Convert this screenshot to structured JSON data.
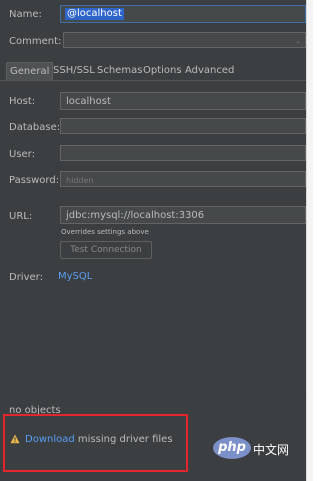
{
  "form": {
    "name_label": "Name:",
    "name_value": "@localhost",
    "comment_label": "Comment:",
    "comment_value": ""
  },
  "tabs": [
    {
      "label": "General",
      "active": true
    },
    {
      "label": "SSH/SSL",
      "active": false
    },
    {
      "label": "Schemas",
      "active": false
    },
    {
      "label": "Options",
      "active": false
    },
    {
      "label": "Advanced",
      "active": false
    }
  ],
  "general": {
    "host_label": "Host:",
    "host_value": "localhost",
    "database_label": "Database:",
    "database_value": "",
    "user_label": "User:",
    "user_value": "",
    "password_label": "Password:",
    "password_placeholder": "hidden",
    "url_label": "URL:",
    "url_value": "jdbc:mysql://localhost:3306",
    "url_hint": "Overrides settings above",
    "test_connection_label": "Test Connection",
    "driver_label": "Driver:",
    "driver_value": "MySQL"
  },
  "status": {
    "objects_text": "no objects",
    "download_link": "Download",
    "missing_text": "missing driver files"
  },
  "watermark": {
    "logo_text": "php",
    "site_text": "中文网"
  },
  "colors": {
    "background": "#3c3f41",
    "link": "#589df6",
    "selection": "#2f65ca",
    "highlight_box": "#e2262b",
    "warning": "#e8b64a"
  }
}
